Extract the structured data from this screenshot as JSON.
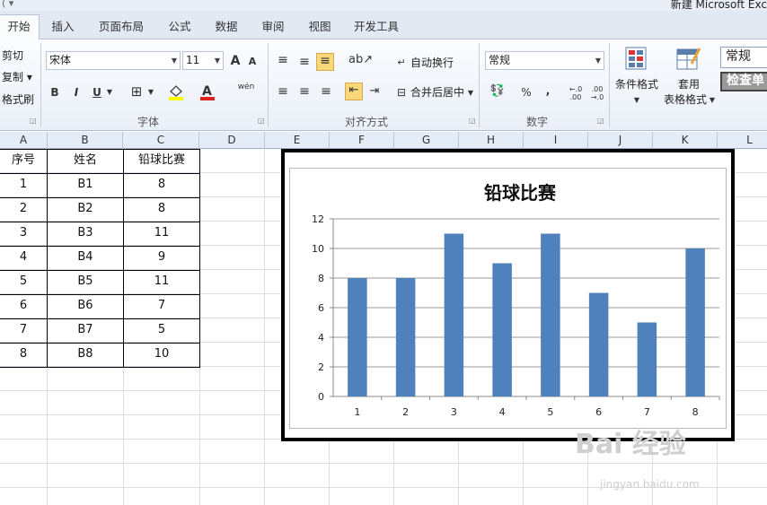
{
  "window": {
    "title": "新建 Microsoft Exc",
    "qat": "(  ▾"
  },
  "tabs": [
    "开始",
    "插入",
    "页面布局",
    "公式",
    "数据",
    "审阅",
    "视图",
    "开发工具"
  ],
  "clipboard": {
    "cut": "剪切",
    "copy": "复制 ▾",
    "format_painter": "格式刷"
  },
  "font_group": {
    "label": "字体",
    "font_name": "宋体",
    "font_size": "11",
    "grow": "A",
    "shrink": "A",
    "bold": "B",
    "italic": "I",
    "underline": "U",
    "phonetic": "wén"
  },
  "alignment_group": {
    "label": "对齐方式",
    "wrap_text": "自动换行",
    "merge_center": "合并后居中"
  },
  "number_group": {
    "label": "数字",
    "format": "常规",
    "percent": "%",
    "comma": ",",
    "inc_dec": ".0 .00"
  },
  "styles_group": {
    "conditional_format": "条件格式",
    "format_as_table_1": "套用",
    "format_as_table_2": "表格格式",
    "style_normal": "常规",
    "style_check": "检查单"
  },
  "columns": [
    "A",
    "B",
    "C",
    "D",
    "E",
    "F",
    "G",
    "H",
    "I",
    "J",
    "K",
    "L"
  ],
  "table": {
    "headers": [
      "序号",
      "姓名",
      "铅球比赛"
    ],
    "rows": [
      [
        "1",
        "B1",
        "8"
      ],
      [
        "2",
        "B2",
        "8"
      ],
      [
        "3",
        "B3",
        "11"
      ],
      [
        "4",
        "B4",
        "9"
      ],
      [
        "5",
        "B5",
        "11"
      ],
      [
        "6",
        "B6",
        "7"
      ],
      [
        "7",
        "B7",
        "5"
      ],
      [
        "8",
        "B8",
        "10"
      ]
    ]
  },
  "chart_data": {
    "type": "bar",
    "title": "铅球比赛",
    "categories": [
      "1",
      "2",
      "3",
      "4",
      "5",
      "6",
      "7",
      "8"
    ],
    "values": [
      8,
      8,
      11,
      9,
      11,
      7,
      5,
      10
    ],
    "ylim": [
      0,
      12
    ],
    "yticks": [
      "0",
      "2",
      "4",
      "6",
      "8",
      "10",
      "12"
    ],
    "grid": true,
    "bar_color": "#4f81bd",
    "legend": "none"
  },
  "colors": {
    "ribbon_bg": "#eaf0f8",
    "header_bg": "#e4ecf7",
    "bar": "#4f81bd"
  },
  "watermark": {
    "main": "Bai 经验",
    "sub": "jingyan.baidu.com"
  }
}
